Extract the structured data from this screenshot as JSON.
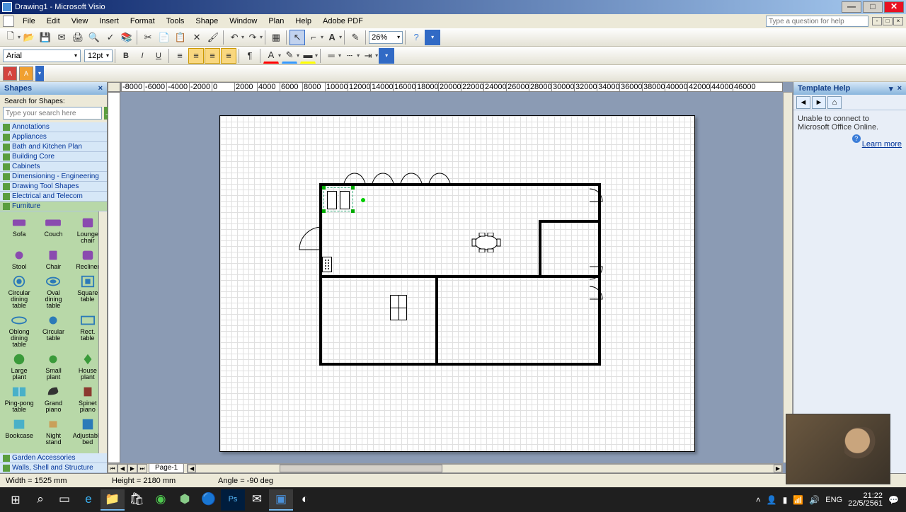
{
  "window": {
    "title": "Drawing1 - Microsoft Visio"
  },
  "menus": [
    "File",
    "Edit",
    "View",
    "Insert",
    "Format",
    "Tools",
    "Shape",
    "Window",
    "Plan",
    "Help",
    "Adobe PDF"
  ],
  "help_search_placeholder": "Type a question for help",
  "zoom": "26%",
  "font": {
    "name": "Arial",
    "size": "12pt"
  },
  "shapes_panel": {
    "title": "Shapes",
    "search_label": "Search for Shapes:",
    "search_placeholder": "Type your search here",
    "stencils_top": [
      "Annotations",
      "Appliances",
      "Bath and Kitchen Plan",
      "Building Core",
      "Cabinets",
      "Dimensioning - Engineering",
      "Drawing Tool Shapes",
      "Electrical and Telecom",
      "Furniture"
    ],
    "stencils_bottom": [
      "Garden Accessories",
      "Walls, Shell and Structure"
    ],
    "furniture": [
      "Sofa",
      "Couch",
      "Lounge chair",
      "Stool",
      "Chair",
      "Recliner",
      "Circular dining table",
      "Oval dining table",
      "Square table",
      "Oblong dining table",
      "Circular table",
      "Rect. table",
      "Large plant",
      "Small plant",
      "House plant",
      "Ping-pong table",
      "Grand piano",
      "Spinet piano",
      "Bookcase",
      "Night stand",
      "Adjustable bed"
    ]
  },
  "ruler_h": [
    "-8000",
    "-6000",
    "-4000",
    "-2000",
    "0",
    "2000",
    "4000",
    "6000",
    "8000",
    "10000",
    "12000",
    "14000",
    "16000",
    "18000",
    "20000",
    "22000",
    "24000",
    "26000",
    "28000",
    "30000",
    "32000",
    "34000",
    "36000",
    "38000",
    "40000",
    "42000",
    "44000",
    "46000"
  ],
  "page_tab": "Page-1",
  "help_panel": {
    "title": "Template Help",
    "body": "Unable to connect to Microsoft Office Online.",
    "link": "Learn more"
  },
  "status": {
    "width": "Width = 1525 mm",
    "height": "Height = 2180 mm",
    "angle": "Angle = -90 deg"
  },
  "tray": {
    "lang": "ENG",
    "time": "21:22",
    "date": "22/5/2561"
  }
}
